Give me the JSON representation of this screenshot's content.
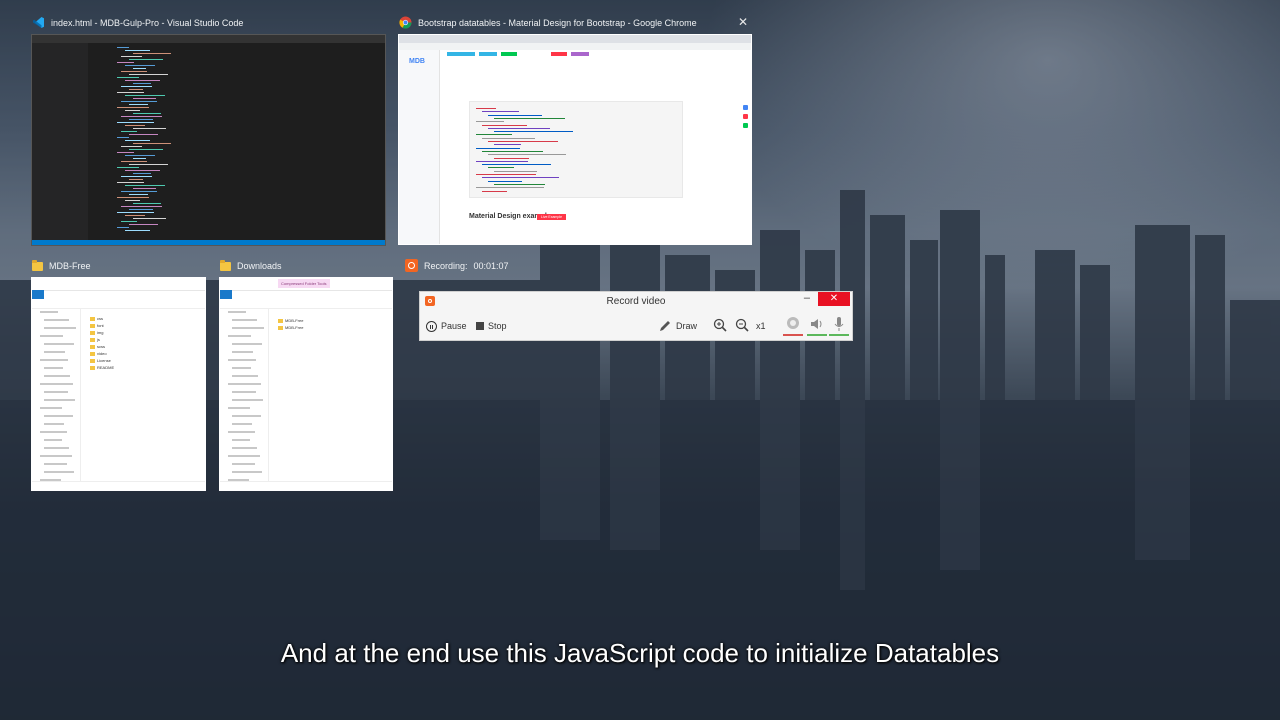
{
  "windows": [
    {
      "title": "index.html - MDB-Gulp-Pro - Visual Studio Code",
      "app": "vscode-icon"
    },
    {
      "title": "Bootstrap datatables - Material Design for Bootstrap - Google Chrome",
      "app": "chrome-icon"
    },
    {
      "title": "MDB-Free",
      "app": "folder-icon"
    },
    {
      "title": "Downloads",
      "app": "folder-icon"
    }
  ],
  "chrome_thumb": {
    "logo": "MDB",
    "heading": "Material Design example",
    "badge": "Live Example"
  },
  "explorer_mdb": {
    "files": [
      "css",
      "font",
      "img",
      "js",
      "scss",
      "video",
      "License",
      "README"
    ],
    "tab": "File"
  },
  "explorer_downloads": {
    "files": [
      "MDB-Free",
      "MDB-Free"
    ],
    "tab": "File",
    "context_tab": "Compressed Folder Tools"
  },
  "recording": {
    "label": "Recording:",
    "time": "00:01:07"
  },
  "record_widget": {
    "title": "Record video",
    "pause": "Pause",
    "stop": "Stop",
    "draw": "Draw",
    "zoom": "x1",
    "colors": {
      "accent": "#f26522",
      "close": "#e81123"
    }
  },
  "caption": "And at the end use this JavaScript code to initialize Datatables"
}
